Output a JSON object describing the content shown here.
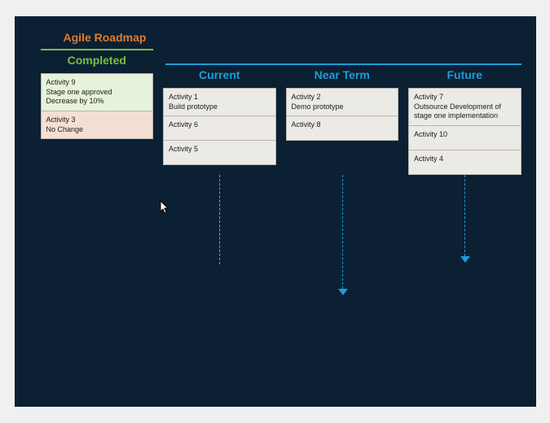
{
  "title": "Agile Roadmap",
  "columns": {
    "completed": {
      "header": "Completed",
      "cards": [
        {
          "title": "Activity 9",
          "sub1": "Stage one approved",
          "sub2": "Decrease by 10%"
        },
        {
          "title": "Activity 3",
          "sub1": "No Change",
          "sub2": ""
        }
      ]
    },
    "current": {
      "header": "Current",
      "cards": [
        {
          "title": "Activity 1",
          "sub1": "Build prototype",
          "sub2": ""
        },
        {
          "title": "Activity 6",
          "sub1": "",
          "sub2": ""
        },
        {
          "title": "Activity 5",
          "sub1": "",
          "sub2": ""
        }
      ]
    },
    "nearterm": {
      "header": "Near Term",
      "cards": [
        {
          "title": "Activity 2",
          "sub1": "Demo prototype",
          "sub2": ""
        },
        {
          "title": "Activity 8",
          "sub1": "",
          "sub2": ""
        }
      ]
    },
    "future": {
      "header": "Future",
      "cards": [
        {
          "title": "Activity 7",
          "sub1": "Outsource Development of stage one implementation",
          "sub2": ""
        },
        {
          "title": "Activity 10",
          "sub1": "",
          "sub2": ""
        },
        {
          "title": "Activity 4",
          "sub1": "",
          "sub2": ""
        }
      ]
    }
  }
}
